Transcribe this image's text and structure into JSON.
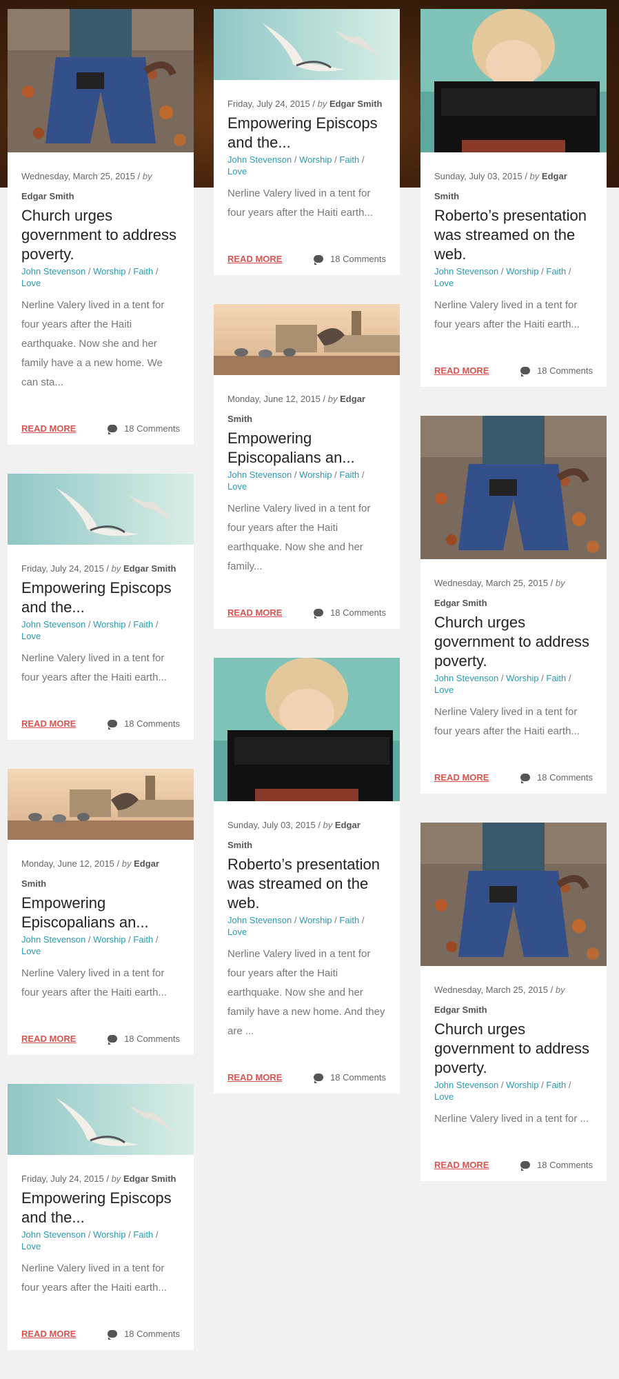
{
  "common": {
    "by": "by",
    "categories": [
      "John Stevenson",
      "Worship",
      "Faith",
      "Love"
    ],
    "read_more": "READ MORE",
    "comments": "18 Comments"
  },
  "columns": [
    [
      {
        "image": "kneeling-man",
        "date": "Wednesday, March 25, 2015",
        "author": "Edgar Smith",
        "title": "Church urges government to address poverty.",
        "excerpt": "Nerline Valery lived in a tent for four years after the Haiti earthquake. Now she and her family have a a new home. We can sta..."
      },
      {
        "image": "seagulls",
        "date": "Friday, July 24, 2015",
        "author": "Edgar Smith",
        "title": "Empowering Episcops and the...",
        "excerpt": "Nerline Valery lived in a tent for four years after the Haiti earth..."
      },
      {
        "image": "pigeons-london",
        "date": "Monday, June 12, 2015",
        "author": "Edgar Smith",
        "title": "Empowering Episcopalians an...",
        "excerpt": "Nerline Valery lived in a tent for four years after the Haiti earth..."
      },
      {
        "image": "seagulls",
        "date": "Friday, July 24, 2015",
        "author": "Edgar Smith",
        "title": "Empowering Episcops and the...",
        "excerpt": "Nerline Valery lived in a tent for four years after the Haiti earth..."
      }
    ],
    [
      {
        "image": "seagulls",
        "date": "Friday, July 24, 2015",
        "author": "Edgar Smith",
        "title": "Empowering Episcops and the...",
        "excerpt": "Nerline Valery lived in a tent for four years after the Haiti earth..."
      },
      {
        "image": "pigeons-london",
        "date": "Monday, June 12, 2015",
        "author": "Edgar Smith",
        "title": "Empowering Episcopalians an...",
        "excerpt": "Nerline Valery lived in a tent for four years after the Haiti earthquake. Now she and her family..."
      },
      {
        "image": "child-bench",
        "date": "Sunday, July 03, 2015",
        "author": "Edgar Smith",
        "title": "Roberto’s presentation was streamed on the web.",
        "excerpt": "Nerline Valery lived in a tent for four years after the Haiti earthquake. Now she and her family have a new home. And they are ..."
      }
    ],
    [
      {
        "image": "child-bench",
        "date": "Sunday, July 03, 2015",
        "author": "Edgar Smith",
        "title": "Roberto’s presentation was streamed on the web.",
        "excerpt": "Nerline Valery lived in a tent for four years after the Haiti earth..."
      },
      {
        "image": "kneeling-man",
        "date": "Wednesday, March 25, 2015",
        "author": "Edgar Smith",
        "title": "Church urges government to address poverty.",
        "excerpt": "Nerline Valery lived in a tent for four years after the Haiti earth..."
      },
      {
        "image": "kneeling-man",
        "date": "Wednesday, March 25, 2015",
        "author": "Edgar Smith",
        "title": "Church urges government to address poverty.",
        "excerpt": "Nerline Valery lived in a tent for ..."
      }
    ]
  ]
}
